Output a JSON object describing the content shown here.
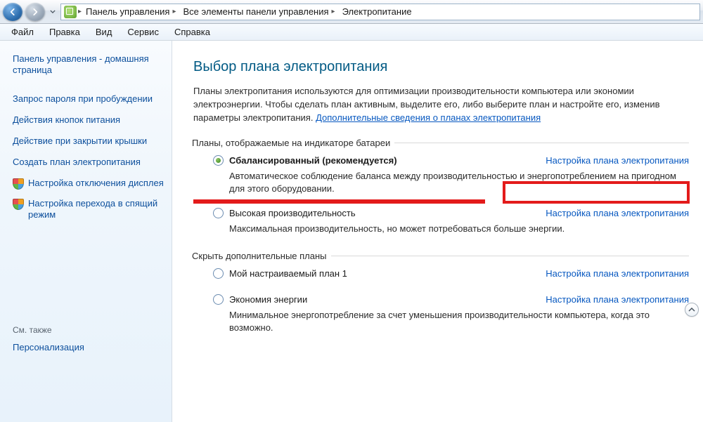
{
  "breadcrumb": {
    "items": [
      "Панель управления",
      "Все элементы панели управления",
      "Электропитание"
    ]
  },
  "menubar": [
    "Файл",
    "Правка",
    "Вид",
    "Сервис",
    "Справка"
  ],
  "sidebar": {
    "home": "Панель управления - домашняя страница",
    "links": [
      "Запрос пароля при пробуждении",
      "Действия кнопок питания",
      "Действие при закрытии крышки",
      "Создать план электропитания"
    ],
    "shielded": [
      "Настройка отключения дисплея",
      "Настройка перехода в спящий режим"
    ],
    "see_also_header": "См. также",
    "see_also": [
      "Персонализация"
    ]
  },
  "content": {
    "title": "Выбор плана электропитания",
    "intro_part1": "Планы электропитания используются для оптимизации производительности компьютера или экономии электроэнергии. Чтобы сделать план активным, выделите его, либо выберите план и настройте его, изменив параметры электропитания. ",
    "intro_link": "Дополнительные сведения о планах электропитания",
    "group1_legend": "Планы, отображаемые на индикаторе батареи",
    "group2_legend": "Скрыть дополнительные планы",
    "plans": [
      {
        "name": "Сбалансированный (рекомендуется)",
        "desc": "Автоматическое соблюдение баланса между производительностью и энергопотреблением на пригодном для этого оборудовании.",
        "link": "Настройка плана электропитания",
        "checked": true,
        "bold": true
      },
      {
        "name": "Высокая производительность",
        "desc": "Максимальная производительность, но может потребоваться больше энергии.",
        "link": "Настройка плана электропитания",
        "checked": false,
        "bold": false
      },
      {
        "name": "Мой настраиваемый план 1",
        "desc": "",
        "link": "Настройка плана электропитания",
        "checked": false,
        "bold": false
      },
      {
        "name": "Экономия энергии",
        "desc": "Минимальное энергопотребление за счет уменьшения производительности компьютера, когда это возможно.",
        "link": "Настройка плана электропитания",
        "checked": false,
        "bold": false
      }
    ]
  }
}
